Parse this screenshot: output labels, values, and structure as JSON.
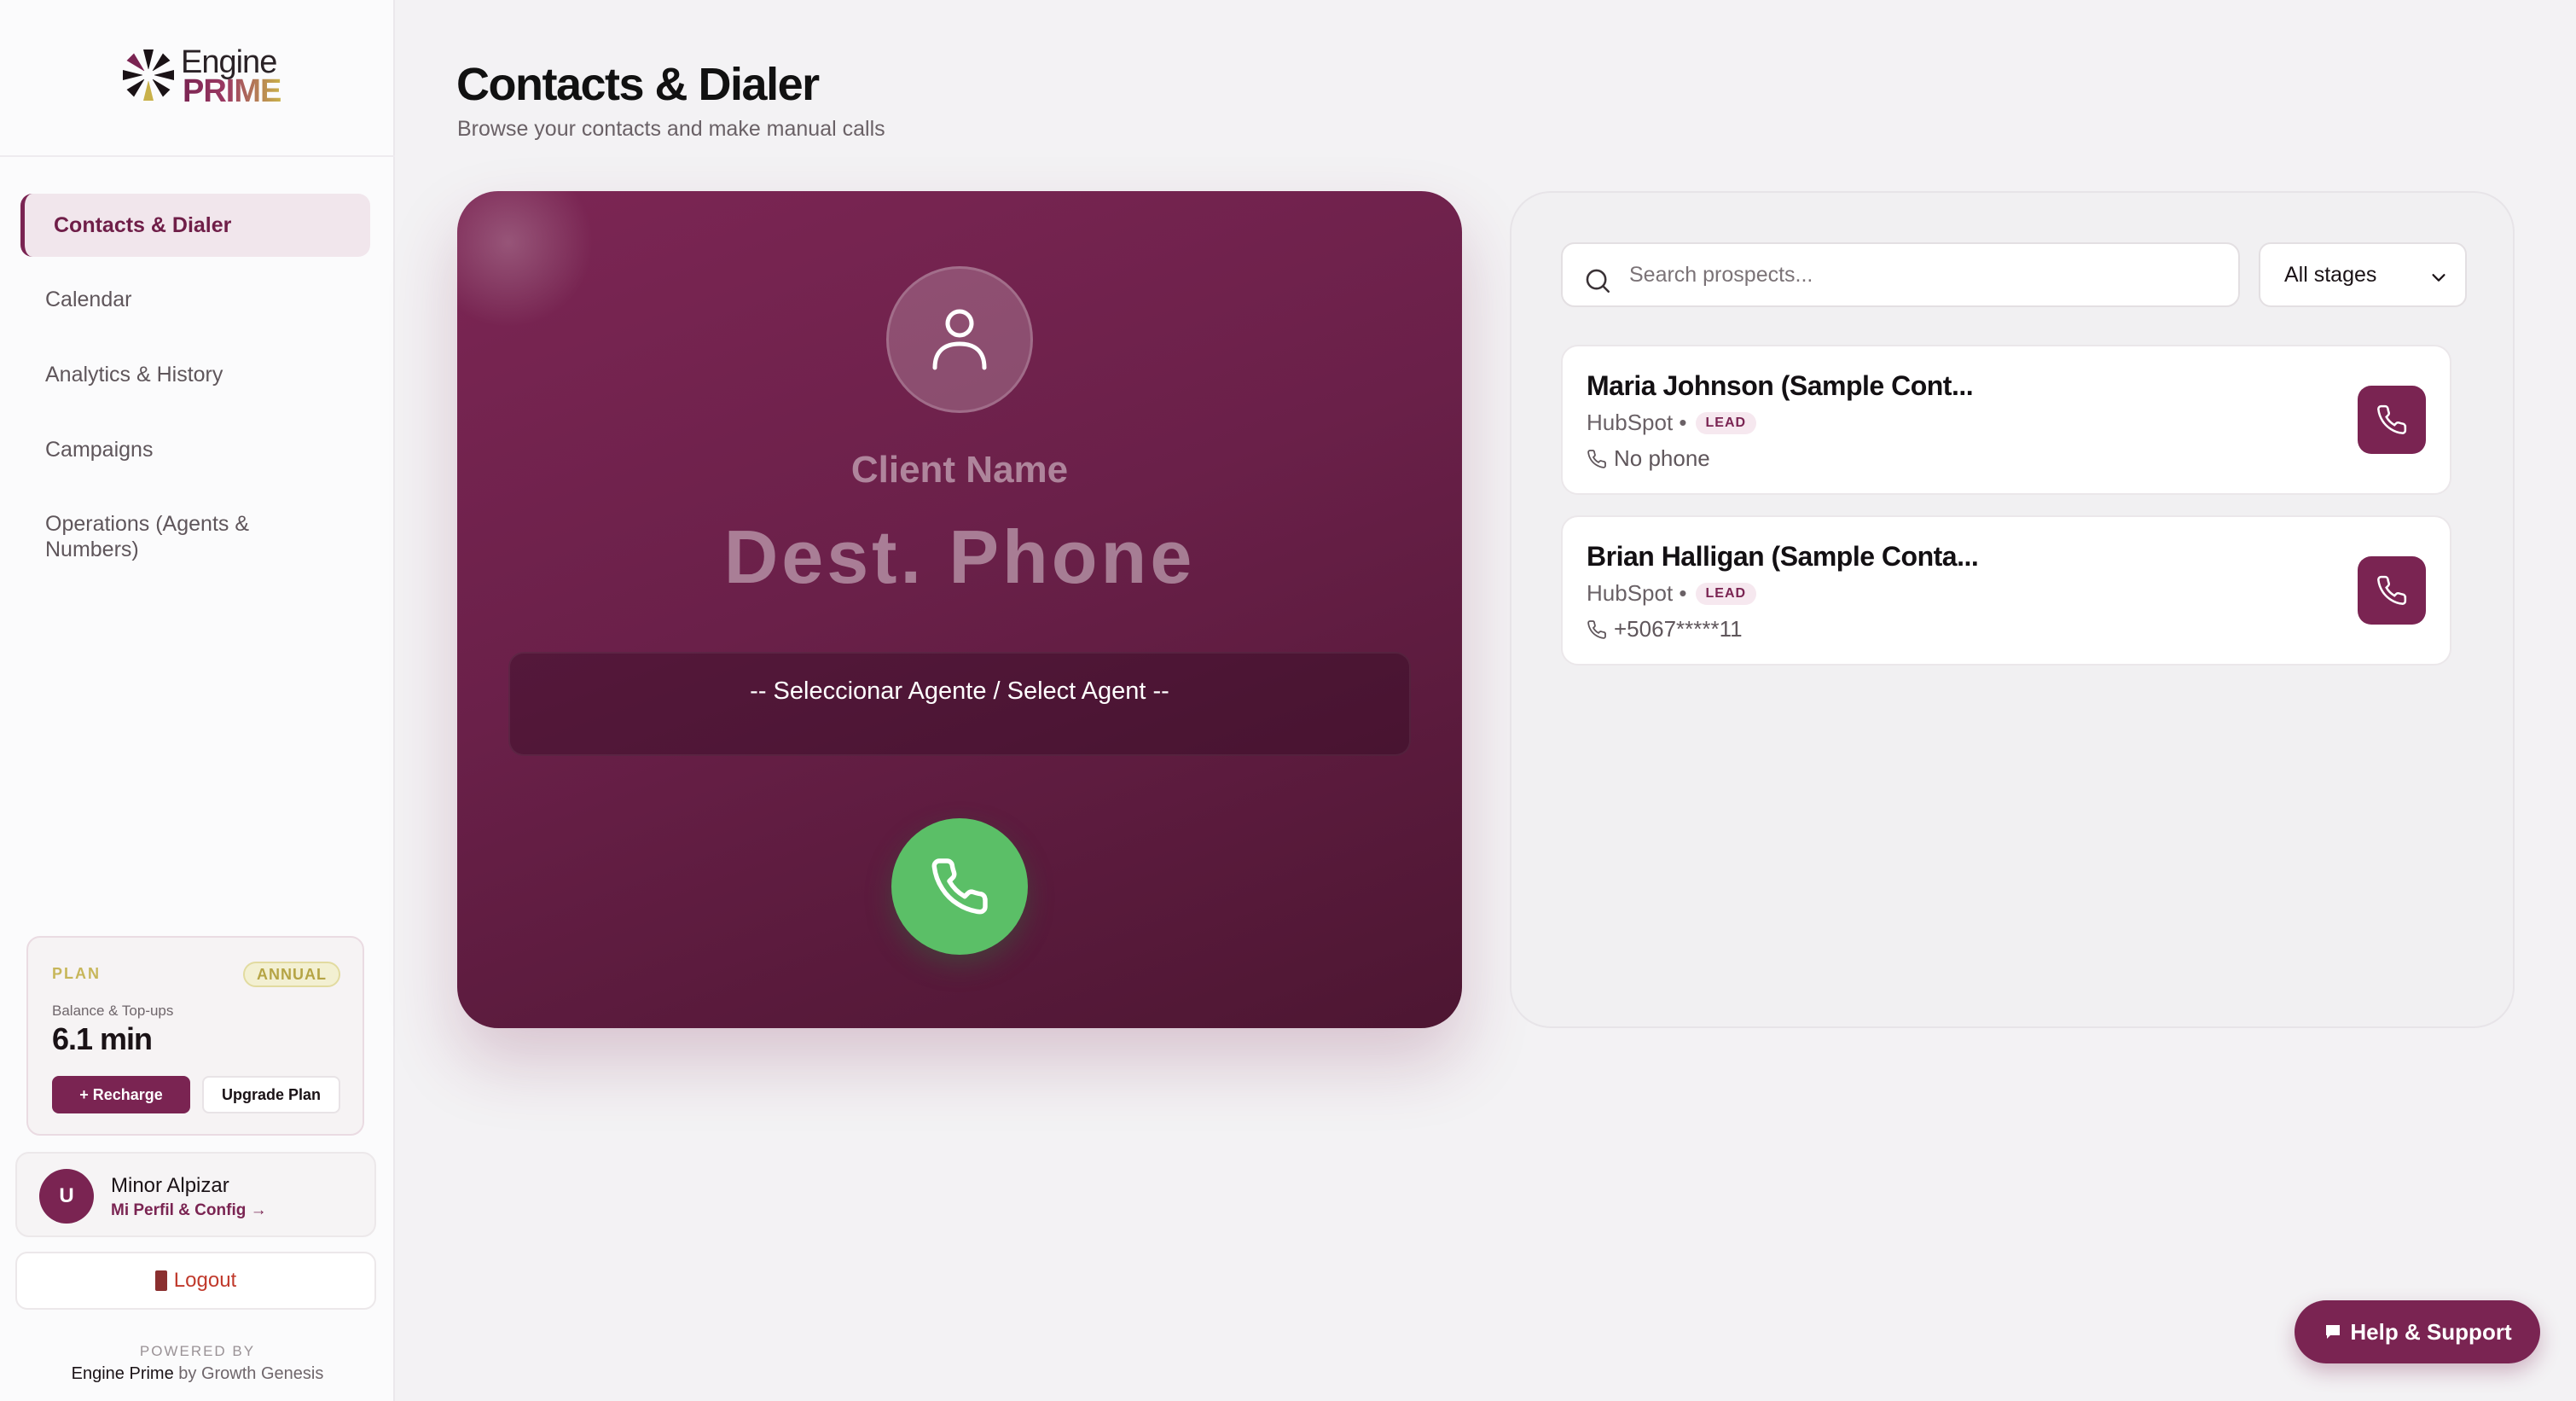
{
  "brand": {
    "logo_word_1": "Engine",
    "logo_word_2": "PRIME",
    "accent_color": "#7a2452",
    "gold_color": "#c9b14a"
  },
  "sidebar": {
    "items": [
      {
        "label": "Contacts & Dialer",
        "active": true
      },
      {
        "label": "Calendar",
        "active": false
      },
      {
        "label": "Analytics & History",
        "active": false
      },
      {
        "label": "Campaigns",
        "active": false
      },
      {
        "label": "Operations (Agents & Numbers)",
        "active": false
      }
    ],
    "plan": {
      "label": "PLAN",
      "badge": "ANNUAL",
      "balance_label": "Balance & Top-ups",
      "balance_value": "6.1 min",
      "recharge_label": "+ Recharge",
      "upgrade_label": "Upgrade Plan"
    },
    "user": {
      "initial": "U",
      "name": "Minor Alpizar",
      "link": "Mi Perfil & Config →"
    },
    "logout_label": "Logout",
    "powered_by": "POWERED BY",
    "powered_brand": "Engine Prime",
    "powered_suffix": "by Growth Genesis"
  },
  "header": {
    "title": "Contacts & Dialer",
    "subtitle": "Browse your contacts and make manual calls"
  },
  "dialer": {
    "client_name": "Client Name",
    "dest_phone": "Dest. Phone",
    "agent_select": "-- Seleccionar Agente / Select Agent --",
    "call_color": "#5bbf67"
  },
  "contacts": {
    "search_placeholder": "Search prospects...",
    "stage_filter": "All stages",
    "list": [
      {
        "name": "Maria Johnson (Sample Cont...",
        "source": "HubSpot •",
        "badge": "LEAD",
        "phone": "No phone"
      },
      {
        "name": "Brian Halligan (Sample Conta...",
        "source": "HubSpot •",
        "badge": "LEAD",
        "phone": "+5067*****11"
      }
    ]
  },
  "help_label": "Help & Support",
  "icons": [
    "logo-icon",
    "user-icon",
    "phone-icon",
    "search-icon",
    "chevron-down-icon",
    "chat-icon",
    "door-icon"
  ]
}
